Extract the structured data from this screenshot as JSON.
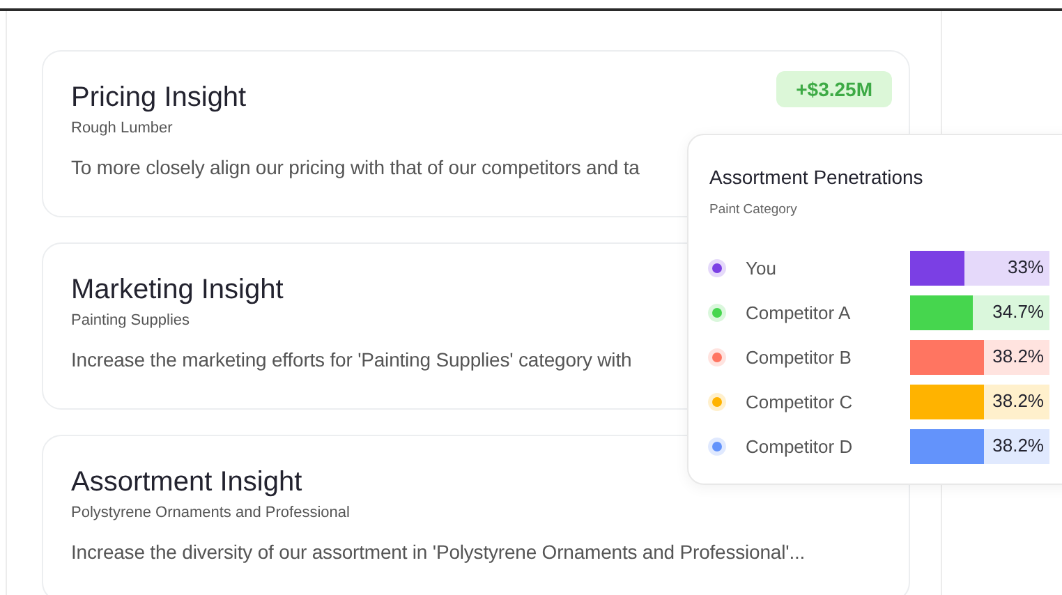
{
  "cards": [
    {
      "title": "Pricing Insight",
      "subtitle": "Rough Lumber",
      "text": "To more closely align our pricing with that of our competitors and ta",
      "badge": "+$3.25M"
    },
    {
      "title": "Marketing Insight",
      "subtitle": "Painting Supplies",
      "text": "Increase the marketing efforts for 'Painting Supplies' category with"
    },
    {
      "title": "Assortment Insight",
      "subtitle": "Polystyrene Ornaments and Professional",
      "text": "Increase the diversity of our assortment in 'Polystyrene Ornaments and Professional'..."
    }
  ],
  "popover": {
    "title": "Assortment Penetrations",
    "subtitle": "Paint Category",
    "rows": [
      {
        "name": "You",
        "color": "#7b3fe4",
        "level": 0.39,
        "reading": "33%"
      },
      {
        "name": "Competitor A",
        "color": "#46d64e",
        "level": 0.45,
        "reading": "34.7%"
      },
      {
        "name": "Competitor B",
        "color": "#ff7561",
        "level": 0.53,
        "reading": "38.2%"
      },
      {
        "name": "Competitor C",
        "color": "#ffb300",
        "level": 0.53,
        "reading": "38.2%"
      },
      {
        "name": "Competitor D",
        "color": "#6393fb",
        "level": 0.53,
        "reading": "38.2%"
      }
    ]
  }
}
